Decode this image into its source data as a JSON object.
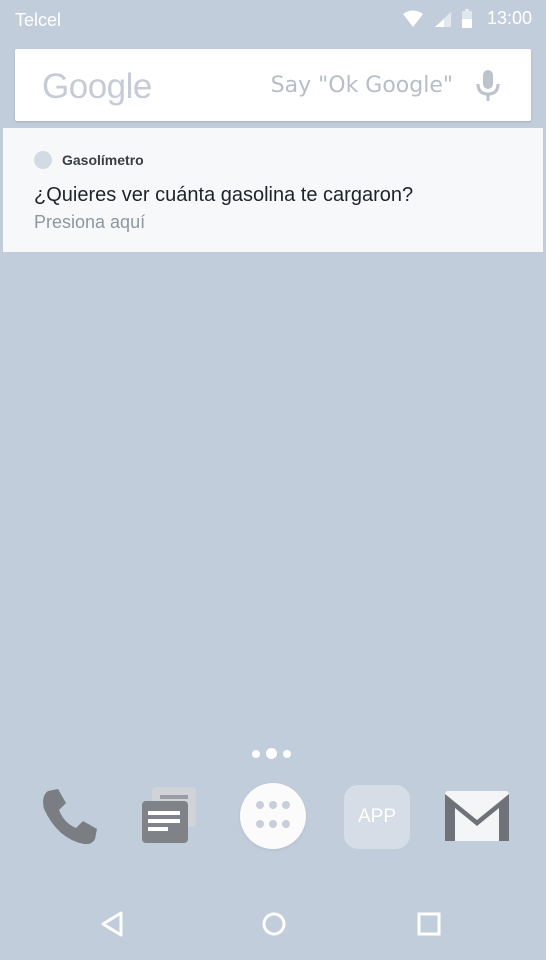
{
  "status_bar": {
    "carrier": "Telcel",
    "time": "13:00",
    "icons": [
      "wifi-icon",
      "signal-icon",
      "battery-icon"
    ]
  },
  "search": {
    "logo": "Google",
    "hint": "Say \"Ok Google\"",
    "mic_icon": "mic-icon"
  },
  "notification": {
    "app_name": "Gasolímetro",
    "title": "¿Quieres ver cuánta gasolina te cargaron?",
    "text": "Presiona aquí"
  },
  "page_indicator": {
    "pages": 3,
    "current": 2
  },
  "dock": {
    "items": [
      {
        "icon": "phone-icon"
      },
      {
        "icon": "messages-icon"
      },
      {
        "icon": "all-apps-icon"
      },
      {
        "icon": "app-icon",
        "label": "APP"
      },
      {
        "icon": "gmail-icon"
      }
    ]
  },
  "nav": {
    "back": "back-icon",
    "home": "home-icon",
    "recents": "recents-icon"
  },
  "colors": {
    "wallpaper": "#c2cddb",
    "notification_bg": "#f7f8fa",
    "icon_gray": "#777a7f"
  }
}
